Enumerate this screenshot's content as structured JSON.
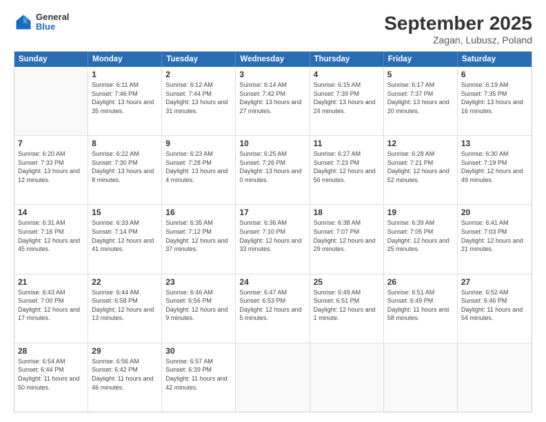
{
  "header": {
    "logo": {
      "general": "General",
      "blue": "Blue"
    },
    "title": "September 2025",
    "subtitle": "Zagan, Lubusz, Poland"
  },
  "calendar": {
    "days_of_week": [
      "Sunday",
      "Monday",
      "Tuesday",
      "Wednesday",
      "Thursday",
      "Friday",
      "Saturday"
    ],
    "weeks": [
      [
        {
          "day": "",
          "empty": true
        },
        {
          "day": "1",
          "sunrise": "Sunrise: 6:11 AM",
          "sunset": "Sunset: 7:46 PM",
          "daylight": "Daylight: 13 hours and 35 minutes."
        },
        {
          "day": "2",
          "sunrise": "Sunrise: 6:12 AM",
          "sunset": "Sunset: 7:44 PM",
          "daylight": "Daylight: 13 hours and 31 minutes."
        },
        {
          "day": "3",
          "sunrise": "Sunrise: 6:14 AM",
          "sunset": "Sunset: 7:42 PM",
          "daylight": "Daylight: 13 hours and 27 minutes."
        },
        {
          "day": "4",
          "sunrise": "Sunrise: 6:15 AM",
          "sunset": "Sunset: 7:39 PM",
          "daylight": "Daylight: 13 hours and 24 minutes."
        },
        {
          "day": "5",
          "sunrise": "Sunrise: 6:17 AM",
          "sunset": "Sunset: 7:37 PM",
          "daylight": "Daylight: 13 hours and 20 minutes."
        },
        {
          "day": "6",
          "sunrise": "Sunrise: 6:19 AM",
          "sunset": "Sunset: 7:35 PM",
          "daylight": "Daylight: 13 hours and 16 minutes."
        }
      ],
      [
        {
          "day": "7",
          "sunrise": "Sunrise: 6:20 AM",
          "sunset": "Sunset: 7:33 PM",
          "daylight": "Daylight: 13 hours and 12 minutes."
        },
        {
          "day": "8",
          "sunrise": "Sunrise: 6:22 AM",
          "sunset": "Sunset: 7:30 PM",
          "daylight": "Daylight: 13 hours and 8 minutes."
        },
        {
          "day": "9",
          "sunrise": "Sunrise: 6:23 AM",
          "sunset": "Sunset: 7:28 PM",
          "daylight": "Daylight: 13 hours and 4 minutes."
        },
        {
          "day": "10",
          "sunrise": "Sunrise: 6:25 AM",
          "sunset": "Sunset: 7:26 PM",
          "daylight": "Daylight: 13 hours and 0 minutes."
        },
        {
          "day": "11",
          "sunrise": "Sunrise: 6:27 AM",
          "sunset": "Sunset: 7:23 PM",
          "daylight": "Daylight: 12 hours and 56 minutes."
        },
        {
          "day": "12",
          "sunrise": "Sunrise: 6:28 AM",
          "sunset": "Sunset: 7:21 PM",
          "daylight": "Daylight: 12 hours and 52 minutes."
        },
        {
          "day": "13",
          "sunrise": "Sunrise: 6:30 AM",
          "sunset": "Sunset: 7:19 PM",
          "daylight": "Daylight: 12 hours and 49 minutes."
        }
      ],
      [
        {
          "day": "14",
          "sunrise": "Sunrise: 6:31 AM",
          "sunset": "Sunset: 7:16 PM",
          "daylight": "Daylight: 12 hours and 45 minutes."
        },
        {
          "day": "15",
          "sunrise": "Sunrise: 6:33 AM",
          "sunset": "Sunset: 7:14 PM",
          "daylight": "Daylight: 12 hours and 41 minutes."
        },
        {
          "day": "16",
          "sunrise": "Sunrise: 6:35 AM",
          "sunset": "Sunset: 7:12 PM",
          "daylight": "Daylight: 12 hours and 37 minutes."
        },
        {
          "day": "17",
          "sunrise": "Sunrise: 6:36 AM",
          "sunset": "Sunset: 7:10 PM",
          "daylight": "Daylight: 12 hours and 33 minutes."
        },
        {
          "day": "18",
          "sunrise": "Sunrise: 6:38 AM",
          "sunset": "Sunset: 7:07 PM",
          "daylight": "Daylight: 12 hours and 29 minutes."
        },
        {
          "day": "19",
          "sunrise": "Sunrise: 6:39 AM",
          "sunset": "Sunset: 7:05 PM",
          "daylight": "Daylight: 12 hours and 25 minutes."
        },
        {
          "day": "20",
          "sunrise": "Sunrise: 6:41 AM",
          "sunset": "Sunset: 7:03 PM",
          "daylight": "Daylight: 12 hours and 21 minutes."
        }
      ],
      [
        {
          "day": "21",
          "sunrise": "Sunrise: 6:43 AM",
          "sunset": "Sunset: 7:00 PM",
          "daylight": "Daylight: 12 hours and 17 minutes."
        },
        {
          "day": "22",
          "sunrise": "Sunrise: 6:44 AM",
          "sunset": "Sunset: 6:58 PM",
          "daylight": "Daylight: 12 hours and 13 minutes."
        },
        {
          "day": "23",
          "sunrise": "Sunrise: 6:46 AM",
          "sunset": "Sunset: 6:56 PM",
          "daylight": "Daylight: 12 hours and 9 minutes."
        },
        {
          "day": "24",
          "sunrise": "Sunrise: 6:47 AM",
          "sunset": "Sunset: 6:53 PM",
          "daylight": "Daylight: 12 hours and 5 minutes."
        },
        {
          "day": "25",
          "sunrise": "Sunrise: 6:49 AM",
          "sunset": "Sunset: 6:51 PM",
          "daylight": "Daylight: 12 hours and 1 minute."
        },
        {
          "day": "26",
          "sunrise": "Sunrise: 6:51 AM",
          "sunset": "Sunset: 6:49 PM",
          "daylight": "Daylight: 11 hours and 58 minutes."
        },
        {
          "day": "27",
          "sunrise": "Sunrise: 6:52 AM",
          "sunset": "Sunset: 6:46 PM",
          "daylight": "Daylight: 11 hours and 54 minutes."
        }
      ],
      [
        {
          "day": "28",
          "sunrise": "Sunrise: 6:54 AM",
          "sunset": "Sunset: 6:44 PM",
          "daylight": "Daylight: 11 hours and 50 minutes."
        },
        {
          "day": "29",
          "sunrise": "Sunrise: 6:56 AM",
          "sunset": "Sunset: 6:42 PM",
          "daylight": "Daylight: 11 hours and 46 minutes."
        },
        {
          "day": "30",
          "sunrise": "Sunrise: 6:57 AM",
          "sunset": "Sunset: 6:39 PM",
          "daylight": "Daylight: 11 hours and 42 minutes."
        },
        {
          "day": "",
          "empty": true
        },
        {
          "day": "",
          "empty": true
        },
        {
          "day": "",
          "empty": true
        },
        {
          "day": "",
          "empty": true
        }
      ]
    ]
  }
}
